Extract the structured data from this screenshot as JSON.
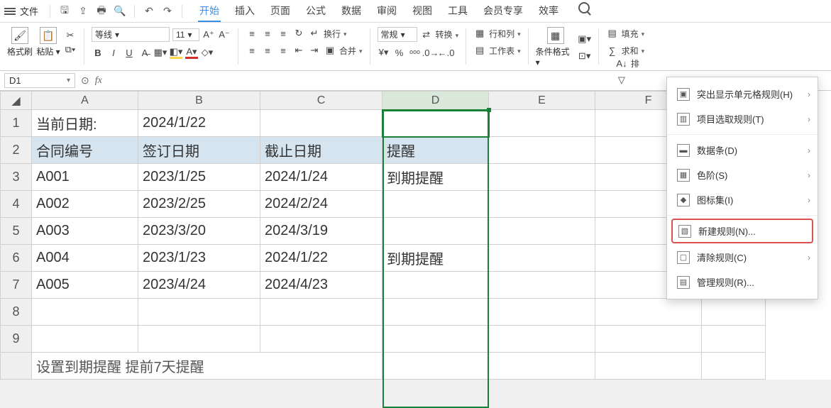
{
  "menubar": {
    "file": "文件"
  },
  "tabs": {
    "start": "开始",
    "insert": "插入",
    "page": "页面",
    "formula": "公式",
    "data": "数据",
    "review": "审阅",
    "view": "视图",
    "tools": "工具",
    "member": "会员专享",
    "efficiency": "效率"
  },
  "ribbon": {
    "format_painter": "格式刷",
    "paste": "粘贴",
    "font_name": "等线",
    "font_size": "11",
    "general": "常规",
    "convert": "转换",
    "wrap": "换行",
    "merge": "合并",
    "row_col": "行和列",
    "worksheet": "工作表",
    "cond_fmt": "条件格式",
    "fill": "填充",
    "sum": "求和",
    "sort": "排"
  },
  "fxbar": {
    "cell_ref": "D1"
  },
  "columns": [
    "A",
    "B",
    "C",
    "D",
    "E",
    "F"
  ],
  "rows": [
    "1",
    "2",
    "3",
    "4",
    "5",
    "6",
    "7",
    "8",
    "9"
  ],
  "cells": {
    "A1": "当前日期:",
    "B1": "2024/1/22",
    "A2": "合同编号",
    "B2": "签订日期",
    "C2": "截止日期",
    "D2": "提醒",
    "A3": "A001",
    "B3": "2023/1/25",
    "C3": "2024/1/24",
    "D3": "到期提醒",
    "A4": "A002",
    "B4": "2023/2/25",
    "C4": "2024/2/24",
    "A5": "A003",
    "B5": "2023/3/20",
    "C5": "2024/3/19",
    "A6": "A004",
    "B6": "2023/1/23",
    "C6": "2024/1/22",
    "D6": "到期提醒",
    "A7": "A005",
    "B7": "2023/4/24",
    "C7": "2024/4/23",
    "footer_partial": "设置到期提醒   提前7天提醒"
  },
  "cf_menu": {
    "highlight": "突出显示单元格规则(H)",
    "top": "项目选取规则(T)",
    "databar": "数据条(D)",
    "colorscale": "色阶(S)",
    "iconset": "图标集(I)",
    "newrule": "新建规则(N)...",
    "clear": "清除规则(C)",
    "manage": "管理规则(R)..."
  }
}
